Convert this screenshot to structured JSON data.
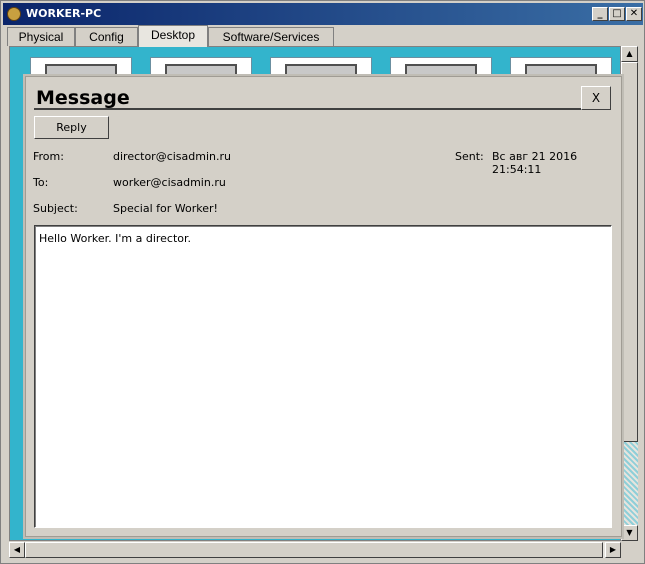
{
  "window": {
    "title": "WORKER-PC",
    "controls": {
      "minimize": "_",
      "maximize": "□",
      "close": "✕"
    }
  },
  "tabs": [
    {
      "label": "Physical",
      "active": false
    },
    {
      "label": "Config",
      "active": false
    },
    {
      "label": "Desktop",
      "active": true
    },
    {
      "label": "Software/Services",
      "active": false
    }
  ],
  "message": {
    "title": "Message",
    "close_label": "X",
    "reply_label": "Reply",
    "from_label": "From:",
    "from_value": "director@cisadmin.ru",
    "sent_label": "Sent:",
    "sent_value": "Вс авг 21 2016 21:54:11",
    "to_label": "To:",
    "to_value": "worker@cisadmin.ru",
    "subject_label": "Subject:",
    "subject_value": "Special for Worker!",
    "body": "Hello Worker. I'm a director."
  },
  "colors": {
    "desktop_bg": "#33b4cc",
    "titlebar": "#0a246a",
    "dialog_bg": "#d4d0c8"
  }
}
